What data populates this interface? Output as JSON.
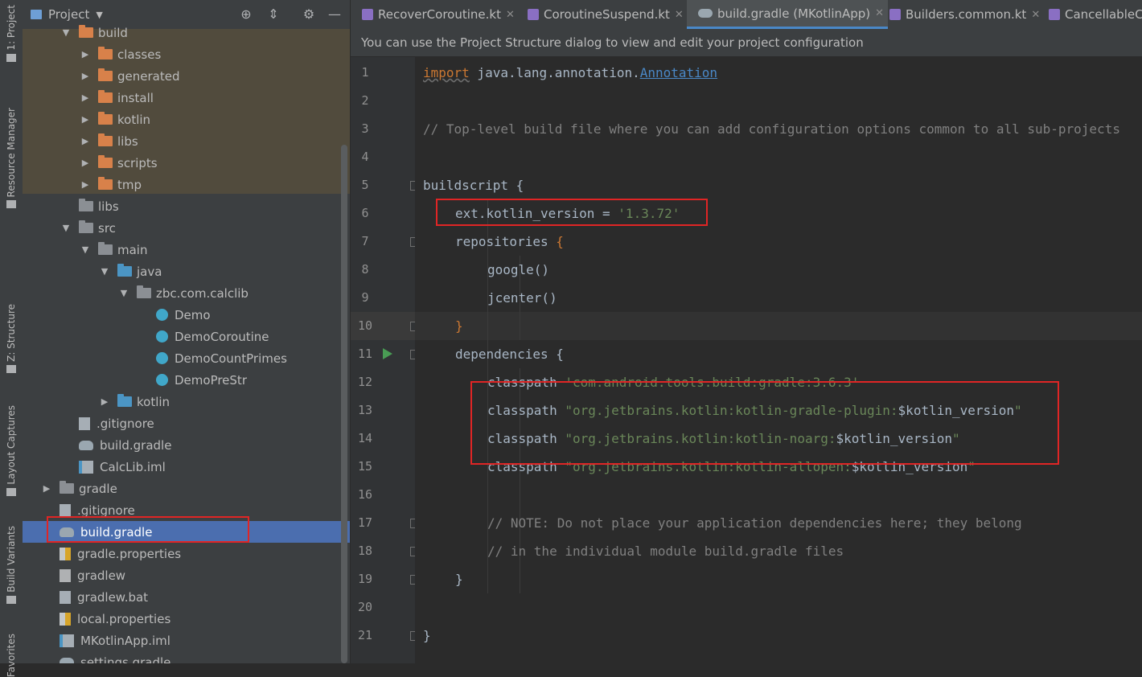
{
  "tool_strip": [
    {
      "label": "1: Project"
    },
    {
      "label": "Resource Manager"
    },
    {
      "label": "Z: Structure"
    },
    {
      "label": "Layout Captures"
    },
    {
      "label": "Build Variants"
    },
    {
      "label": "Favorites"
    }
  ],
  "project_panel": {
    "title": "Project",
    "tree": [
      {
        "label": "build",
        "type": "folder-orange",
        "expanded": true
      },
      {
        "label": "classes",
        "type": "folder-orange"
      },
      {
        "label": "generated",
        "type": "folder-orange"
      },
      {
        "label": "install",
        "type": "folder-orange"
      },
      {
        "label": "kotlin",
        "type": "folder-orange"
      },
      {
        "label": "libs",
        "type": "folder-orange"
      },
      {
        "label": "scripts",
        "type": "folder-orange"
      },
      {
        "label": "tmp",
        "type": "folder-orange"
      },
      {
        "label": "libs",
        "type": "folder"
      },
      {
        "label": "src",
        "type": "folder",
        "expanded": true
      },
      {
        "label": "main",
        "type": "folder",
        "expanded": true
      },
      {
        "label": "java",
        "type": "folder-blue",
        "expanded": true
      },
      {
        "label": "zbc.com.calclib",
        "type": "folder",
        "expanded": true
      },
      {
        "label": "Demo",
        "type": "kt"
      },
      {
        "label": "DemoCoroutine",
        "type": "kt"
      },
      {
        "label": "DemoCountPrimes",
        "type": "kt"
      },
      {
        "label": "DemoPreStr",
        "type": "kt"
      },
      {
        "label": "kotlin",
        "type": "folder-blue"
      },
      {
        "label": ".gitignore",
        "type": "doc"
      },
      {
        "label": "build.gradle",
        "type": "gradle"
      },
      {
        "label": "CalcLib.iml",
        "type": "iml"
      },
      {
        "label": "gradle",
        "type": "folder"
      },
      {
        "label": ".gitignore",
        "type": "doc"
      },
      {
        "label": "build.gradle",
        "type": "gradle",
        "selected": true
      },
      {
        "label": "gradle.properties",
        "type": "props"
      },
      {
        "label": "gradlew",
        "type": "term"
      },
      {
        "label": "gradlew.bat",
        "type": "doc"
      },
      {
        "label": "local.properties",
        "type": "props"
      },
      {
        "label": "MKotlinApp.iml",
        "type": "iml"
      },
      {
        "label": "settings.gradle",
        "type": "gradle"
      }
    ]
  },
  "tabs": [
    {
      "label": "RecoverCoroutine.kt",
      "icon": "kotlin-file-icon"
    },
    {
      "label": "CoroutineSuspend.kt",
      "icon": "kotlin-file-icon"
    },
    {
      "label": "build.gradle (MKotlinApp)",
      "icon": "gradle-icon",
      "active": true
    },
    {
      "label": "Builders.common.kt",
      "icon": "kotlin-file-icon"
    },
    {
      "label": "CancellableCo",
      "icon": "kotlin-file-icon"
    }
  ],
  "banner": "You can use the Project Structure dialog to view and edit your project configuration",
  "code": {
    "line_numbers": [
      "1",
      "2",
      "3",
      "4",
      "5",
      "6",
      "7",
      "8",
      "9",
      "10",
      "11",
      "12",
      "13",
      "14",
      "15",
      "16",
      "17",
      "18",
      "19",
      "20",
      "21"
    ],
    "l1_kw": "import",
    "l1_pkg": " java.lang.annotation.",
    "l1_cls": "Annotation",
    "l3": "// Top-level build file where you can add configuration options common to all sub-projects",
    "l5": "buildscript {",
    "l6_a": "ext.kotlin_version = ",
    "l6_b": "'1.3.72'",
    "l7_a": "repositories ",
    "l7_b": "{",
    "l8": "google()",
    "l9": "jcenter()",
    "l10": "}",
    "l11": "dependencies {",
    "l12_a": "classpath ",
    "l12_b": "'com.android.tools.build:gradle:3.6.3'",
    "l13_a": "classpath ",
    "l13_b": "\"org.jetbrains.kotlin:kotlin-gradle-plugin:",
    "l13_c": "$kotlin_version",
    "l13_d": "\"",
    "l14_a": "classpath ",
    "l14_b": "\"org.jetbrains.kotlin:kotlin-noarg:",
    "l14_c": "$kotlin_version",
    "l14_d": "\"",
    "l15_a": "classpath ",
    "l15_b": "\"org.jetbrains.kotlin:kotlin-allopen:",
    "l15_c": "$kotlin_version",
    "l15_d": "\"",
    "l17": "// NOTE: Do not place your application dependencies here; they belong",
    "l18": "// in the individual module build.gradle files",
    "l19": "}",
    "l21": "}"
  },
  "colors": {
    "keyword": "#cc7832",
    "string": "#6a8759",
    "comment": "#808080",
    "selection": "#4b6eaf",
    "highlight_box": "#e02525"
  }
}
